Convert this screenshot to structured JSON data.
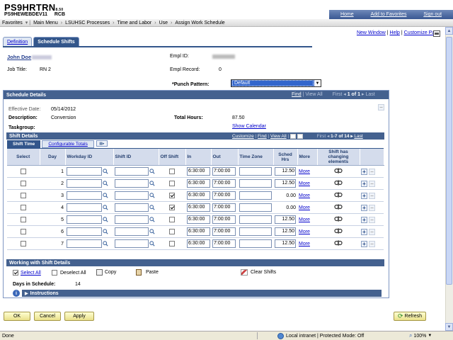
{
  "header": {
    "app_title": "PS9HRTRN",
    "app_version": "8.50",
    "db_name": "PS9HEWEBDEV11",
    "user_code": "RCB",
    "top_links": [
      "Home",
      "Add to Favorites",
      "Sign out"
    ]
  },
  "breadcrumbs": [
    "Favorites",
    "Main Menu",
    "LSUHSC Processes",
    "Time and Labor",
    "Use",
    "Assign Work Schedule"
  ],
  "page_tools": {
    "new_window": "New Window",
    "help": "Help",
    "customize": "Customize Page"
  },
  "tabs": [
    {
      "label": "Definition",
      "active": false
    },
    {
      "label": "Schedule Shifts",
      "active": true
    }
  ],
  "employee": {
    "name": "John Doe",
    "job_title_label": "Job Title:",
    "job_title": "RN 2",
    "empl_id_label": "Empl ID:",
    "empl_record_label": "Empl Record:",
    "empl_record": "0",
    "punch_pattern_label": "*Punch Pattern:",
    "punch_pattern": "Default"
  },
  "schedule_details": {
    "title": "Schedule Details",
    "nav": {
      "find": "Find",
      "view_all": "View All",
      "first": "First",
      "range": "1 of 1",
      "last": "Last"
    },
    "effective_date_label": "Effective Date:",
    "effective_date": "05/14/2012",
    "description_label": "Description:",
    "description": "Conversion",
    "total_hours_label": "Total Hours:",
    "total_hours": "87.50",
    "show_calendar": "Show Calendar",
    "taskgroup_label": "Taskgroup:"
  },
  "shift_details": {
    "title": "Shift Details",
    "nav": {
      "customize": "Customize",
      "find": "Find",
      "view_all": "View All",
      "first": "First",
      "range": "1-7 of 14",
      "last": "Last"
    },
    "subtabs": [
      "Shift Time",
      "Configurable Totals"
    ],
    "columns": [
      "Select",
      "Day",
      "Workday ID",
      "Shift ID",
      "Off Shift",
      "In",
      "Out",
      "Time Zone",
      "Sched Hrs",
      "More",
      "Shift has changing elements"
    ],
    "rows": [
      {
        "day": "1",
        "off": false,
        "in": "6:30:00",
        "out": "7:00:00",
        "hrs": "12.50",
        "hrs_field": true,
        "more": "More"
      },
      {
        "day": "2",
        "off": false,
        "in": "6:30:00",
        "out": "7:00:00",
        "hrs": "12.50",
        "hrs_field": true,
        "more": "More"
      },
      {
        "day": "3",
        "off": true,
        "in": "6:30:00",
        "out": "7:00:00",
        "hrs": "0.00",
        "hrs_field": false,
        "more": "More"
      },
      {
        "day": "4",
        "off": true,
        "in": "6:30:00",
        "out": "7:00:00",
        "hrs": "0.00",
        "hrs_field": false,
        "more": "More"
      },
      {
        "day": "5",
        "off": false,
        "in": "6:30:00",
        "out": "7:00:00",
        "hrs": "12.50",
        "hrs_field": true,
        "more": "More"
      },
      {
        "day": "6",
        "off": false,
        "in": "6:30:00",
        "out": "7:00:00",
        "hrs": "12.50",
        "hrs_field": true,
        "more": "More"
      },
      {
        "day": "7",
        "off": false,
        "in": "6:30:00",
        "out": "7:00:00",
        "hrs": "12.50",
        "hrs_field": true,
        "more": "More"
      }
    ]
  },
  "working": {
    "title": "Working with Shift Details",
    "select_all": "Select All",
    "deselect_all": "Deselect All",
    "copy": "Copy",
    "paste": "Paste",
    "clear_shifts": "Clear Shifts",
    "days_label": "Days in Schedule:",
    "days_value": "14",
    "instructions": "Instructions"
  },
  "buttons": {
    "ok": "OK",
    "cancel": "Cancel",
    "apply": "Apply",
    "refresh": "Refresh"
  },
  "status_bar": {
    "left": "Done",
    "zone": "Local intranet | Protected Mode: Off",
    "zoom": "100%"
  }
}
